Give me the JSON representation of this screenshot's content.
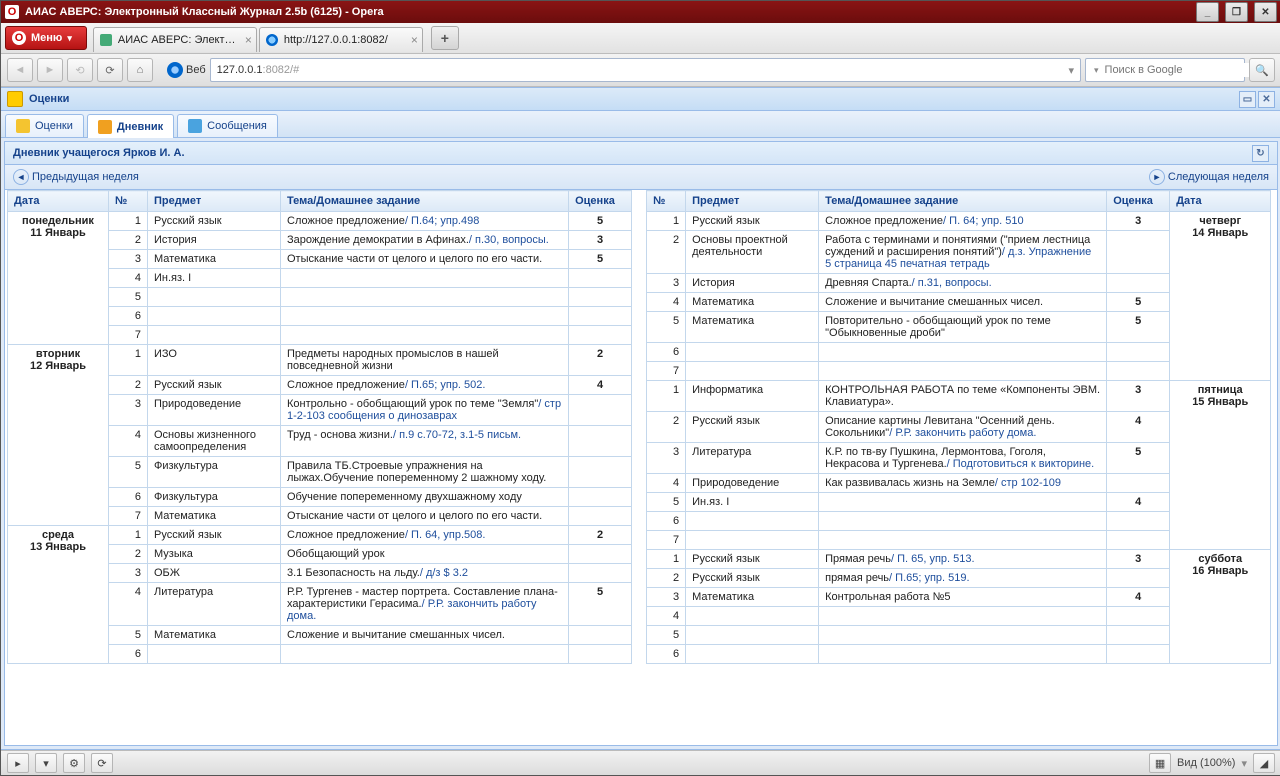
{
  "window_title": "АИАС АВЕРС: Электронный Классный Журнал 2.5b (6125) - Opera",
  "menu_button": "Меню",
  "browser_tabs": [
    {
      "label": "АИАС АВЕРС: Электрон...",
      "favicon": "app"
    },
    {
      "label": "http://127.0.0.1:8082/",
      "favicon": "globe"
    }
  ],
  "address": {
    "scheme": "127.0.0.1",
    "rest": ":8082/#",
    "label": "Веб"
  },
  "search_placeholder": "Поиск в Google",
  "panel_title": "Оценки",
  "app_tabs": [
    {
      "label": "Оценки",
      "color": "#f4c430"
    },
    {
      "label": "Дневник",
      "color": "#f0a020",
      "active": true
    },
    {
      "label": "Сообщения",
      "color": "#4aa3df"
    }
  ],
  "subpanel_title": "Дневник учащегося Ярков И. А.",
  "prev_week": "Предыдущая неделя",
  "next_week": "Следующая неделя",
  "headers": {
    "date": "Дата",
    "num": "№",
    "subject": "Предмет",
    "topic": "Тема/Домашнее задание",
    "grade": "Оценка"
  },
  "left_days": [
    {
      "day_name": "понедельник",
      "day_date": "11 Январь",
      "rows": [
        {
          "n": 1,
          "subj": "Русский язык",
          "topic": "Сложное предложение",
          "hw": "/ П.64; упр.498",
          "grade": "5"
        },
        {
          "n": 2,
          "subj": "История",
          "topic": "Зарождение демократии в Афинах.",
          "hw": "/ п.30, вопросы.",
          "grade": "3"
        },
        {
          "n": 3,
          "subj": "Математика",
          "topic": "Отыскание части от целого и целого по его части.",
          "hw": "",
          "grade": "5"
        },
        {
          "n": 4,
          "subj": "Ин.яз. I",
          "topic": "",
          "hw": "",
          "grade": ""
        },
        {
          "n": 5,
          "subj": "",
          "topic": "",
          "hw": "",
          "grade": ""
        },
        {
          "n": 6,
          "subj": "",
          "topic": "",
          "hw": "",
          "grade": ""
        },
        {
          "n": 7,
          "subj": "",
          "topic": "",
          "hw": "",
          "grade": ""
        }
      ]
    },
    {
      "day_name": "вторник",
      "day_date": "12 Январь",
      "rows": [
        {
          "n": 1,
          "subj": "ИЗО",
          "topic": "Предметы народных промыслов в нашей повседневной жизни",
          "hw": "",
          "grade": "2"
        },
        {
          "n": 2,
          "subj": "Русский язык",
          "topic": "Сложное предложение",
          "hw": "/ П.65; упр. 502.",
          "grade": "4"
        },
        {
          "n": 3,
          "subj": "Природоведение",
          "topic": "Контрольно - обобщающий урок по теме \"Земля\"",
          "hw": "/ стр 1-2-103 сообщения о динозаврах",
          "grade": ""
        },
        {
          "n": 4,
          "subj": "Основы жизненного самоопределения",
          "topic": "Труд - основа жизни.",
          "hw": "/ п.9 с.70-72, з.1-5 письм.",
          "grade": ""
        },
        {
          "n": 5,
          "subj": "Физкультура",
          "topic": "Правила ТБ.Строевые упражнения на лыжах.Обучение попеременному 2 шажному ходу.",
          "hw": "",
          "grade": ""
        },
        {
          "n": 6,
          "subj": "Физкультура",
          "topic": "Обучение попеременному двухшажному ходу",
          "hw": "",
          "grade": ""
        },
        {
          "n": 7,
          "subj": "Математика",
          "topic": "Отыскание части от целого и целого по его части.",
          "hw": "",
          "grade": ""
        }
      ]
    },
    {
      "day_name": "среда",
      "day_date": "13 Январь",
      "rows": [
        {
          "n": 1,
          "subj": "Русский язык",
          "topic": "Сложное предложение",
          "hw": "/ П. 64, упр.508.",
          "grade": "2"
        },
        {
          "n": 2,
          "subj": "Музыка",
          "topic": "Обобщающий урок",
          "hw": "",
          "grade": ""
        },
        {
          "n": 3,
          "subj": "ОБЖ",
          "topic": "3.1 Безопасность на льду.",
          "hw": "/ д/з $ 3.2",
          "grade": ""
        },
        {
          "n": 4,
          "subj": "Литература",
          "topic": "Р.Р. Тургенев - мастер портрета. Составление плана-характеристики Герасима.",
          "hw": "/ Р.Р. закончить работу дома.",
          "grade": "5"
        },
        {
          "n": 5,
          "subj": "Математика",
          "topic": "Сложение и вычитание смешанных чисел.",
          "hw": "",
          "grade": ""
        },
        {
          "n": 6,
          "subj": "",
          "topic": "",
          "hw": "",
          "grade": ""
        }
      ]
    }
  ],
  "right_days": [
    {
      "day_name": "четверг",
      "day_date": "14 Январь",
      "rows": [
        {
          "n": 1,
          "subj": "Русский язык",
          "topic": "Сложное предложение",
          "hw": "/ П. 64; упр. 510",
          "grade": "3"
        },
        {
          "n": 2,
          "subj": "Основы проектной деятельности",
          "topic": "Работа с терминами и понятиями (\"прием лестница суждений и расширения понятий\")",
          "hw": "/ д.з. Упражнение 5 страница 45 печатная тетрадь",
          "grade": ""
        },
        {
          "n": 3,
          "subj": "История",
          "topic": "Древняя Спарта.",
          "hw": "/ п.31, вопросы.",
          "grade": ""
        },
        {
          "n": 4,
          "subj": "Математика",
          "topic": "Сложение и вычитание смешанных чисел.",
          "hw": "",
          "grade": "5"
        },
        {
          "n": 5,
          "subj": "Математика",
          "topic": "Повторительно - обобщающий урок по теме \"Обыкновенные дроби\"",
          "hw": "",
          "grade": "5"
        },
        {
          "n": 6,
          "subj": "",
          "topic": "",
          "hw": "",
          "grade": ""
        },
        {
          "n": 7,
          "subj": "",
          "topic": "",
          "hw": "",
          "grade": ""
        }
      ]
    },
    {
      "day_name": "пятница",
      "day_date": "15 Январь",
      "rows": [
        {
          "n": 1,
          "subj": "Информатика",
          "topic": "КОНТРОЛЬНАЯ РАБОТА по теме «Компоненты ЭВМ. Клавиатура».",
          "hw": "",
          "grade": "3"
        },
        {
          "n": 2,
          "subj": "Русский язык",
          "topic": "Описание картины Левитана \"Осенний день. Сокольники\"",
          "hw": "/ Р.Р. закончить работу дома.",
          "grade": "4"
        },
        {
          "n": 3,
          "subj": "Литература",
          "topic": "К.Р. по тв-ву Пушкина, Лермонтова, Гоголя, Некрасова и Тургенева.",
          "hw": "/ Подготовиться к викторине.",
          "grade": "5"
        },
        {
          "n": 4,
          "subj": "Природоведение",
          "topic": "Как развивалась жизнь на Земле",
          "hw": "/ стр 102-109",
          "grade": ""
        },
        {
          "n": 5,
          "subj": "Ин.яз. I",
          "topic": "",
          "hw": "",
          "grade": "4"
        },
        {
          "n": 6,
          "subj": "",
          "topic": "",
          "hw": "",
          "grade": ""
        },
        {
          "n": 7,
          "subj": "",
          "topic": "",
          "hw": "",
          "grade": ""
        }
      ]
    },
    {
      "day_name": "суббота",
      "day_date": "16 Январь",
      "rows": [
        {
          "n": 1,
          "subj": "Русский язык",
          "topic": "Прямая речь",
          "hw": "/ П. 65, упр. 513.",
          "grade": "3"
        },
        {
          "n": 2,
          "subj": "Русский язык",
          "topic": "прямая речь",
          "hw": "/ П.65; упр. 519.",
          "grade": ""
        },
        {
          "n": 3,
          "subj": "Математика",
          "topic": "Контрольная работа №5",
          "hw": "",
          "grade": "4"
        },
        {
          "n": 4,
          "subj": "",
          "topic": "",
          "hw": "",
          "grade": ""
        },
        {
          "n": 5,
          "subj": "",
          "topic": "",
          "hw": "",
          "grade": ""
        },
        {
          "n": 6,
          "subj": "",
          "topic": "",
          "hw": "",
          "grade": ""
        }
      ]
    }
  ],
  "status": {
    "view": "Вид (100%)"
  }
}
